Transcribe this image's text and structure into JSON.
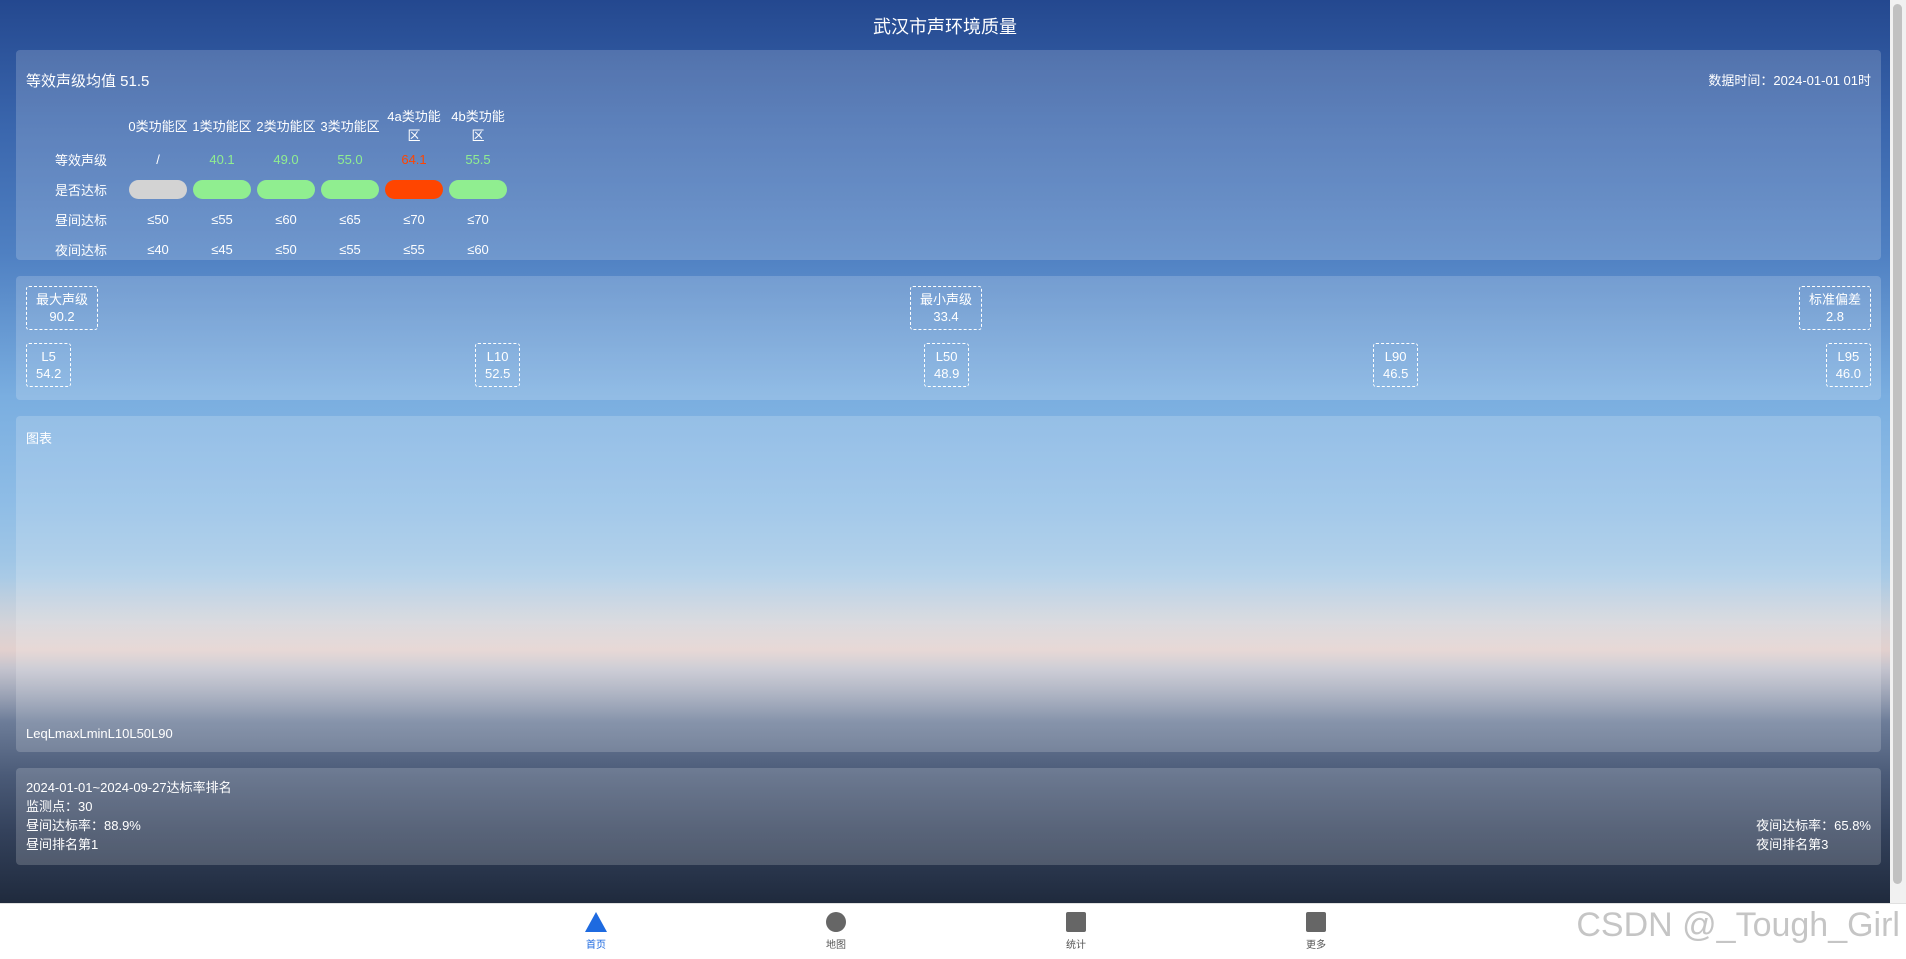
{
  "header": {
    "title": "武汉市声环境质量"
  },
  "summary": {
    "avg_label": "等效声级均值 51.5",
    "data_time": "数据时间：2024-01-01 01时",
    "zones": [
      "0类功能区",
      "1类功能区",
      "2类功能区",
      "3类功能区",
      "4a类功能区",
      "4b类功能区"
    ],
    "rows": {
      "level_label": "等效声级",
      "levels": [
        "/",
        "40.1",
        "49.0",
        "55.0",
        "64.1",
        "55.5"
      ],
      "level_colors": [
        "#ffffff",
        "#90ee90",
        "#90ee90",
        "#90ee90",
        "#ff4500",
        "#90ee90"
      ],
      "met_label": "是否达标",
      "met_colors": [
        "#d3d3d3",
        "#90ee90",
        "#90ee90",
        "#90ee90",
        "#ff4500",
        "#90ee90"
      ],
      "day_label": "昼间达标",
      "day": [
        "≤50",
        "≤55",
        "≤60",
        "≤65",
        "≤70",
        "≤70"
      ],
      "night_label": "夜间达标",
      "night": [
        "≤40",
        "≤45",
        "≤50",
        "≤55",
        "≤55",
        "≤60"
      ]
    }
  },
  "stats": {
    "max": {
      "label": "最大声级",
      "value": "90.2"
    },
    "min": {
      "label": "最小声级",
      "value": "33.4"
    },
    "std": {
      "label": "标准偏差",
      "value": "2.8"
    },
    "l5": {
      "label": "L5",
      "value": "54.2"
    },
    "l10": {
      "label": "L10",
      "value": "52.5"
    },
    "l50": {
      "label": "L50",
      "value": "48.9"
    },
    "l90": {
      "label": "L90",
      "value": "46.5"
    },
    "l95": {
      "label": "L95",
      "value": "46.0"
    }
  },
  "chart": {
    "title": "图表",
    "legend": "LeqLmaxLminL10L50L90"
  },
  "ranking": {
    "title": "2024-01-01~2024-09-27达标率排名",
    "points": "监测点：30",
    "day_rate": "昼间达标率：88.9%",
    "day_rank": "昼间排名第1",
    "night_rate": "夜间达标率：65.8%",
    "night_rank": "夜间排名第3"
  },
  "nav": {
    "colors": {
      "active": "#1e6ae0",
      "inactive": "#666666"
    },
    "items": [
      {
        "label": "首页",
        "icon": "home-triangle-icon"
      },
      {
        "label": "地图",
        "icon": "map-circle-icon"
      },
      {
        "label": "统计",
        "icon": "stats-square-icon"
      },
      {
        "label": "更多",
        "icon": "more-square-icon"
      }
    ]
  },
  "watermark": "CSDN @_Tough_Girl"
}
